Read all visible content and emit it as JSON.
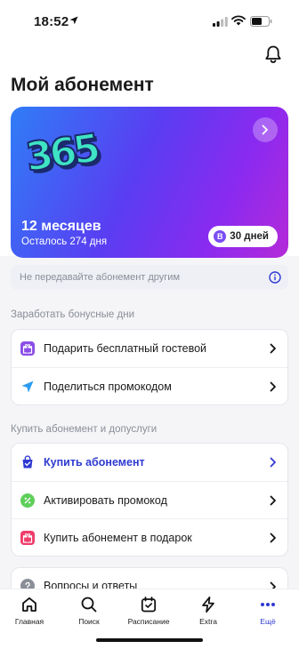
{
  "status_bar": {
    "time": "18:52"
  },
  "header": {
    "title": "Мой абонемент"
  },
  "subscription_card": {
    "logo_text": "365",
    "period": "12 месяцев",
    "remaining": "Осталось 274 дня",
    "bonus_letter": "B",
    "bonus_days": "30 дней",
    "gradient": [
      "#2f7df6",
      "#5a3df2",
      "#8a2af0",
      "#b52ad8"
    ]
  },
  "warning": {
    "text": "Не передавайте абонемент другим"
  },
  "bonus_section": {
    "label": "Заработать бонусные дни",
    "items": [
      {
        "label": "Подарить бесплатный гостевой",
        "icon": "gift-icon",
        "color": "#8a4ee6"
      },
      {
        "label": "Поделиться промокодом",
        "icon": "send-icon",
        "color": "#2d9cf0"
      }
    ]
  },
  "buy_section": {
    "label": "Купить абонемент и допуслуги",
    "items": [
      {
        "label": "Купить абонемент",
        "icon": "shopping-bag-icon",
        "color": "#2e3ad1"
      },
      {
        "label": "Активировать промокод",
        "icon": "discount-icon",
        "color": "#5fcf5a"
      },
      {
        "label": "Купить абонемент в подарок",
        "icon": "gift-icon",
        "color": "#ef3e6b"
      }
    ]
  },
  "faq": {
    "label": "Вопросы и ответы",
    "icon": "question-icon"
  },
  "tabbar": {
    "items": [
      {
        "label": "Главная",
        "icon": "home-icon"
      },
      {
        "label": "Поиск",
        "icon": "search-icon"
      },
      {
        "label": "Расписание",
        "icon": "calendar-icon"
      },
      {
        "label": "Extra",
        "icon": "lightning-icon"
      },
      {
        "label": "Ещё",
        "icon": "more-icon",
        "active": true
      }
    ],
    "active_color": "#2e3ad1"
  }
}
